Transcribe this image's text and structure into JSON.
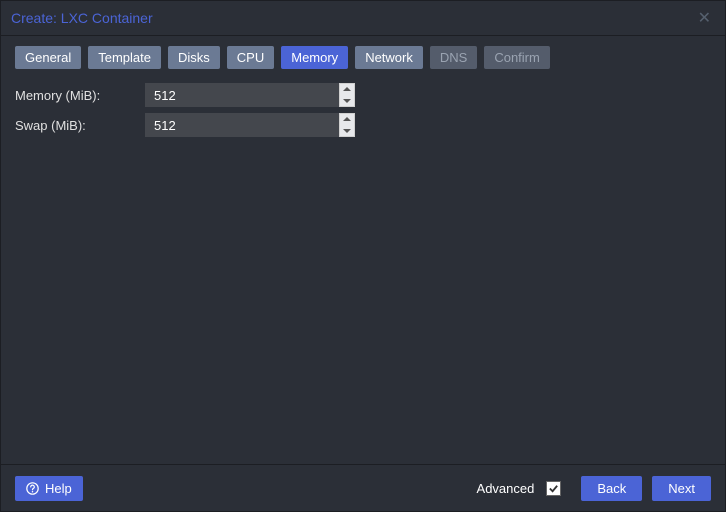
{
  "window": {
    "title": "Create: LXC Container"
  },
  "tabs": {
    "general": "General",
    "template": "Template",
    "disks": "Disks",
    "cpu": "CPU",
    "memory": "Memory",
    "network": "Network",
    "dns": "DNS",
    "confirm": "Confirm"
  },
  "form": {
    "memory_label": "Memory (MiB):",
    "memory_value": "512",
    "swap_label": "Swap (MiB):",
    "swap_value": "512"
  },
  "footer": {
    "help": "Help",
    "advanced": "Advanced",
    "advanced_checked": true,
    "back": "Back",
    "next": "Next"
  }
}
